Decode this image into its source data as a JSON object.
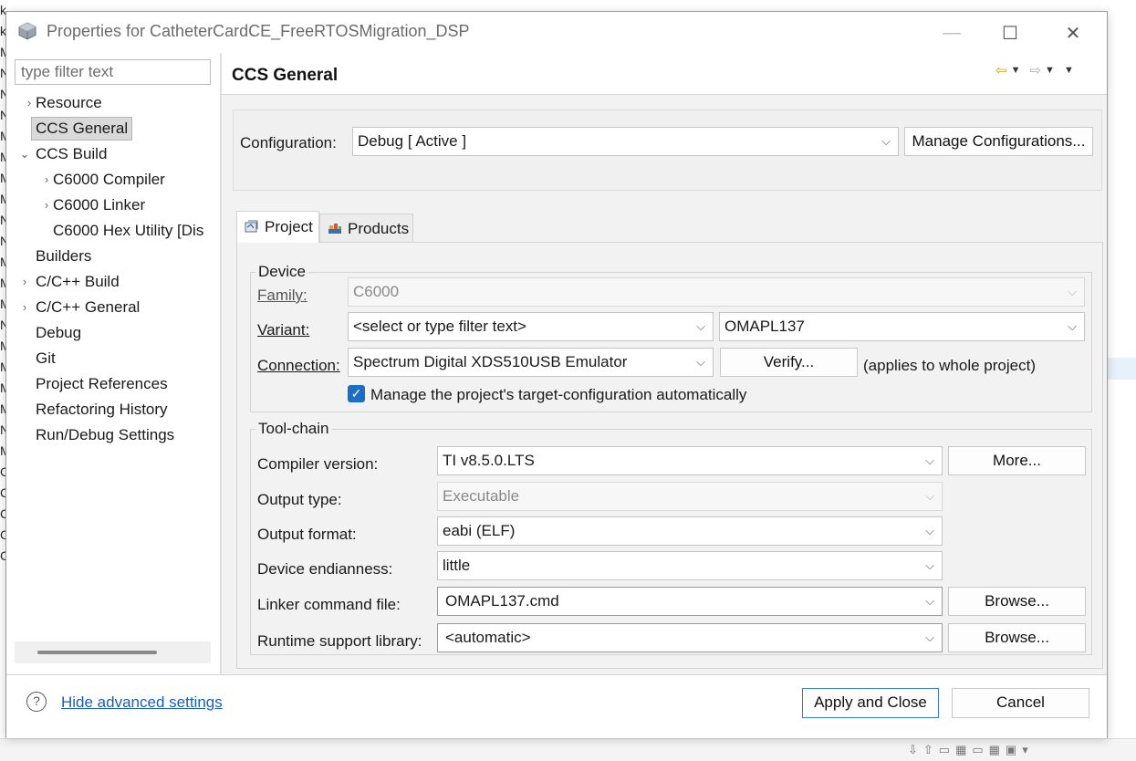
{
  "window": {
    "title": "Properties for CatheterCardCE_FreeRTOSMigration_DSP",
    "minimize": "—",
    "maximize": "☐",
    "close": "✕"
  },
  "filter": {
    "placeholder": "type filter text"
  },
  "tree": {
    "items": [
      {
        "label": "Resource"
      },
      {
        "label": "CCS General"
      },
      {
        "label": "CCS Build"
      },
      {
        "label": "C6000 Compiler"
      },
      {
        "label": "C6000 Linker"
      },
      {
        "label": "C6000 Hex Utility  [Dis"
      },
      {
        "label": "Builders"
      },
      {
        "label": "C/C++ Build"
      },
      {
        "label": "C/C++ General"
      },
      {
        "label": "Debug"
      },
      {
        "label": "Git"
      },
      {
        "label": "Project References"
      },
      {
        "label": "Refactoring History"
      },
      {
        "label": "Run/Debug Settings"
      }
    ]
  },
  "page": {
    "title": "CCS General"
  },
  "config": {
    "label": "Configuration:",
    "value": "Debug  [ Active ]",
    "manage_button": "Manage Configurations..."
  },
  "tabs": {
    "project": "Project",
    "products": "Products"
  },
  "device": {
    "legend": "Device",
    "family_label": "Family:",
    "family_value": "C6000",
    "variant_label": "Variant:",
    "variant_filter": "<select or type filter text>",
    "variant_value": "OMAPL137",
    "connection_label": "Connection:",
    "connection_value": "Spectrum Digital XDS510USB Emulator",
    "verify_button": "Verify...",
    "connection_note": "(applies to whole project)",
    "manage_checkbox": "Manage the project's target-configuration automatically",
    "manage_checked": true
  },
  "toolchain": {
    "legend": "Tool-chain",
    "compiler_label": "Compiler version:",
    "compiler_value": "TI v8.5.0.LTS",
    "more_button": "More...",
    "output_type_label": "Output type:",
    "output_type_value": "Executable",
    "output_format_label": "Output format:",
    "output_format_value": "eabi (ELF)",
    "endianness_label": "Device endianness:",
    "endianness_value": "little",
    "linker_cmd_label": "Linker command file:",
    "linker_cmd_value": "OMAPL137.cmd",
    "browse_button": "Browse...",
    "runtime_label": "Runtime support library:",
    "runtime_value": "<automatic>"
  },
  "footer": {
    "help_icon": "?",
    "hide_advanced": "Hide advanced settings",
    "apply_close": "Apply and Close",
    "cancel": "Cancel"
  },
  "background": {
    "left_edge_chars": [
      "k",
      "k",
      "",
      "",
      "M",
      "N",
      "N",
      "N",
      "M",
      "M",
      "M",
      "M",
      "N",
      "N",
      "M",
      "M",
      "M",
      "N",
      "M",
      "M",
      "M",
      "M",
      "N",
      "M",
      "",
      "",
      "",
      "C",
      "C",
      "C",
      "C",
      "C"
    ]
  }
}
